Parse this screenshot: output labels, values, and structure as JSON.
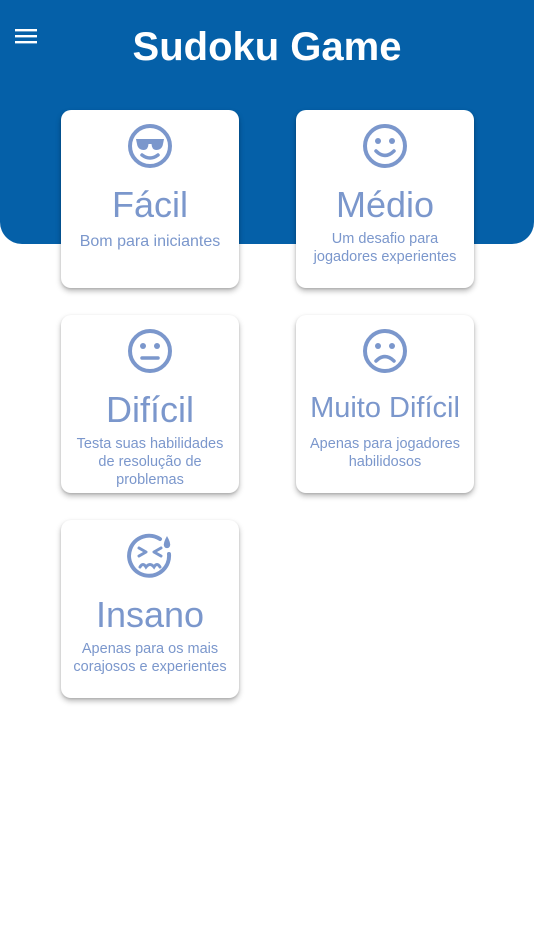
{
  "colors": {
    "header": "#0560a8",
    "accent": "#7b97cc",
    "white": "#ffffff"
  },
  "header": {
    "title": "Sudoku Game",
    "menu_icon": "hamburger-menu-icon"
  },
  "levels": [
    {
      "title": "Fácil",
      "description": "Bom para iniciantes",
      "icon": "cool-face-icon"
    },
    {
      "title": "Médio",
      "description": "Um desafio para jogadores experientes",
      "icon": "smile-face-icon"
    },
    {
      "title": "Difícil",
      "description": "Testa suas habilidades de resolução de problemas",
      "icon": "neutral-face-icon"
    },
    {
      "title": "Muito Difícil",
      "description": "Apenas para jogadores habilidosos",
      "icon": "sad-face-icon"
    },
    {
      "title": "Insano",
      "description": "Apenas para os mais corajosos e experientes",
      "icon": "sweat-face-icon"
    }
  ]
}
